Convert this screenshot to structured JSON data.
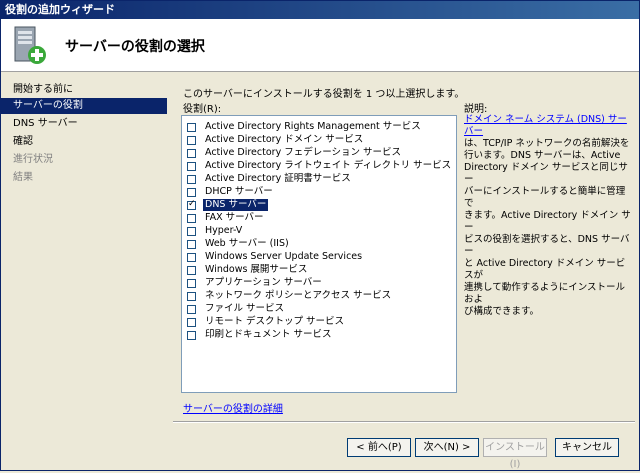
{
  "window": {
    "title": "役割の追加ウィザード"
  },
  "header": {
    "title": "サーバーの役割の選択",
    "icon": "server-add-icon"
  },
  "nav": {
    "items": [
      {
        "label": "開始する前に",
        "state": "normal"
      },
      {
        "label": "サーバーの役割",
        "state": "active"
      },
      {
        "label": "DNS サーバー",
        "state": "normal"
      },
      {
        "label": "確認",
        "state": "normal"
      },
      {
        "label": "進行状況",
        "state": "disabled"
      },
      {
        "label": "結果",
        "state": "disabled"
      }
    ]
  },
  "main": {
    "instruction": "このサーバーにインストールする役割を 1 つ以上選択します。",
    "roles_label": "役割(R):",
    "roles": [
      {
        "label": "Active Directory Rights Management サービス",
        "checked": false
      },
      {
        "label": "Active Directory ドメイン サービス",
        "checked": false
      },
      {
        "label": "Active Directory フェデレーション サービス",
        "checked": false
      },
      {
        "label": "Active Directory ライトウェイト ディレクトリ サービス",
        "checked": false
      },
      {
        "label": "Active Directory 証明書サービス",
        "checked": false
      },
      {
        "label": "DHCP サーバー",
        "checked": false
      },
      {
        "label": "DNS サーバー",
        "checked": true,
        "selected": true
      },
      {
        "label": "FAX サーバー",
        "checked": false
      },
      {
        "label": "Hyper-V",
        "checked": false
      },
      {
        "label": "Web サーバー (IIS)",
        "checked": false
      },
      {
        "label": "Windows Server Update Services",
        "checked": false
      },
      {
        "label": "Windows 展開サービス",
        "checked": false
      },
      {
        "label": "アプリケーション サーバー",
        "checked": false
      },
      {
        "label": "ネットワーク ポリシーとアクセス サービス",
        "checked": false
      },
      {
        "label": "ファイル サービス",
        "checked": false
      },
      {
        "label": "リモート デスクトップ サービス",
        "checked": false
      },
      {
        "label": "印刷とドキュメント サービス",
        "checked": false
      }
    ],
    "description_label": "説明:",
    "description_link": "ドメイン ネーム システム (DNS) サーバー",
    "description_lines": [
      "は、TCP/IP ネットワークの名前解決を",
      "行います。DNS サーバーは、Active",
      "Directory ドメイン サービスと同じサー",
      "バーにインストールすると簡単に管理で",
      "きます。Active Directory ドメイン サー",
      "ビスの役割を選択すると、DNS サーバー",
      "と Active Directory ドメイン サービスが",
      "連携して動作するようにインストールおよ",
      "び構成できます。"
    ],
    "details_link": "サーバーの役割の詳細"
  },
  "buttons": {
    "back": "< 前へ(P)",
    "next": "次へ(N) >",
    "install": "インストール(I)",
    "cancel": "キャンセル"
  }
}
